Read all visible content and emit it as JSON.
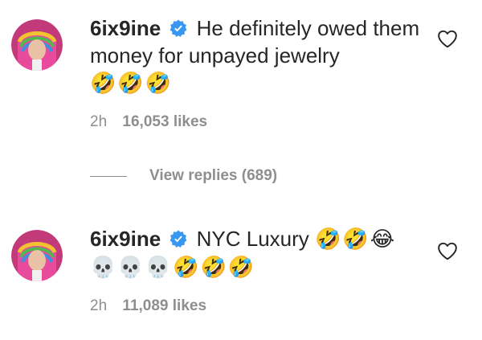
{
  "comments": [
    {
      "username": "6ix9ine",
      "text": "He definitely owed them money for unpayed jewelry",
      "emojis": "🤣🤣🤣",
      "time": "2h",
      "likes": "16,053 likes",
      "verified": true
    },
    {
      "username": "6ix9ine",
      "text": "NYC Luxury",
      "emojis_inline": "🤣🤣😂",
      "emojis_line2": "💀💀💀🤣🤣🤣",
      "time": "2h",
      "likes": "11,089 likes",
      "verified": true
    }
  ],
  "replies": {
    "label": "View replies (689)"
  },
  "colors": {
    "text": "#262626",
    "secondary": "#8e8e8e",
    "verified": "#3897f0"
  },
  "icons": {
    "verified": "verified-badge-icon",
    "heart": "heart-outline-icon"
  }
}
